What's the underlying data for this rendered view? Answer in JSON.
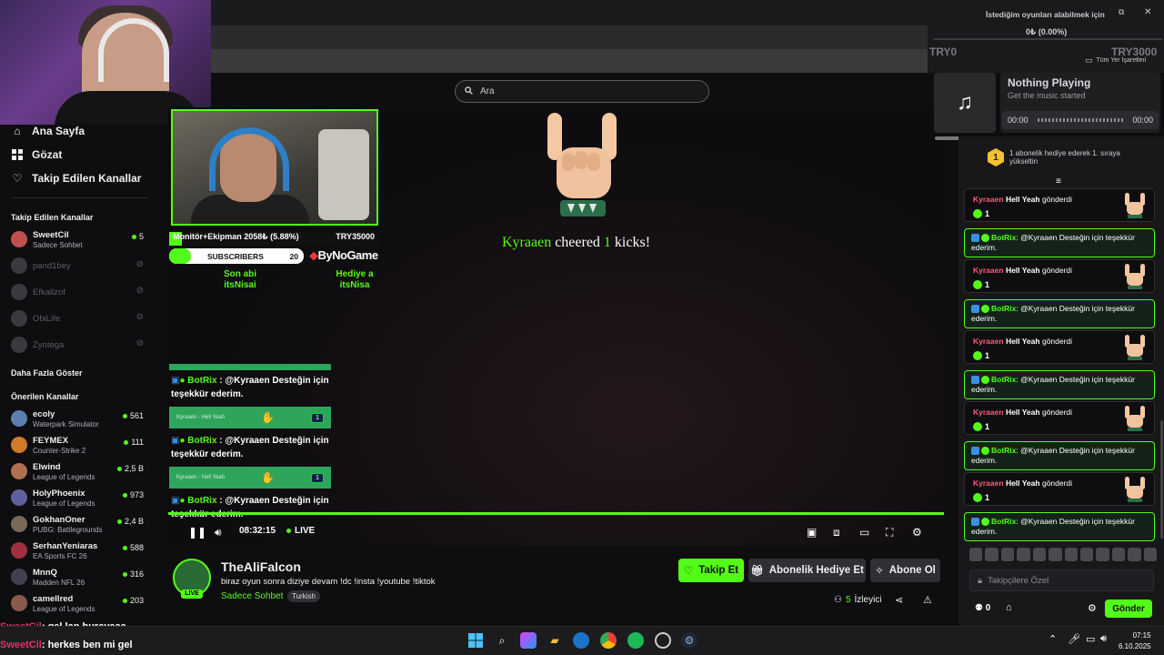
{
  "top": {
    "notice": "İstediğim oyunları alabilmek için",
    "progress": "0₺ (0.00%)",
    "goal_start": "TRY0",
    "goal_end": "TRY3000",
    "bookmarks": "Tüm Yer İşaretleri"
  },
  "search": {
    "placeholder": "Ara"
  },
  "sidebar": {
    "nav": [
      {
        "label": "Ana Sayfa",
        "icon": "home-icon"
      },
      {
        "label": "Gözat",
        "icon": "browse-icon"
      },
      {
        "label": "Takip Edilen Kanallar",
        "icon": "heart-icon"
      }
    ],
    "followed_title": "Takip Edilen Kanallar",
    "followed": [
      {
        "name": "SweetCil",
        "game": "Sadece Sohbet",
        "viewers": "5",
        "online": true,
        "color": "#c0504d"
      },
      {
        "name": "pand1bey",
        "online": false
      },
      {
        "name": "Efkalizof",
        "online": false
      },
      {
        "name": "ObiLife",
        "online": false
      },
      {
        "name": "Zyntega",
        "online": false
      }
    ],
    "show_more": "Daha Fazla Göster",
    "recommended_title": "Önerilen Kanallar",
    "recommended": [
      {
        "name": "ecoly",
        "game": "Waterpark Simulator",
        "viewers": "561",
        "color": "#5a7fb0"
      },
      {
        "name": "FEYMEX",
        "game": "Counter-Strike 2",
        "viewers": "111",
        "color": "#d07a2a"
      },
      {
        "name": "Elwind",
        "game": "League of Legends",
        "viewers": "2,5 B",
        "color": "#b07050"
      },
      {
        "name": "HolyPhoenix",
        "game": "League of Legends",
        "viewers": "973",
        "color": "#6060a0"
      },
      {
        "name": "GokhanOner",
        "game": "PUBG: Battlegrounds",
        "viewers": "2,4 B",
        "color": "#7a6a5a"
      },
      {
        "name": "SerhanYeniaras",
        "game": "EA Sports FC 26",
        "viewers": "588",
        "color": "#a03040"
      },
      {
        "name": "MnnQ",
        "game": "Madden NFL 26",
        "viewers": "316",
        "color": "#404050"
      },
      {
        "name": "camellred",
        "game": "League of Legends",
        "viewers": "203",
        "color": "#8a5a4a"
      }
    ]
  },
  "overlay": {
    "goal_label": "Monitör+Ekipman",
    "goal_value": "2058₺ (5.88%)",
    "goal_target": "TRY35000",
    "subs_label": "SUBSCRIBERS",
    "subs_count": "20",
    "sponsor": "ByNoGame",
    "left_line1": "Son abi",
    "left_line2": "itsNisai",
    "right_line1": "Hediye a",
    "right_line2": "itsNisa",
    "chat": [
      {
        "name": "BotRix",
        "text": ": @Kyraaen Desteğin için teşekkür ederim."
      },
      {
        "name": "BotRix",
        "text": ": @Kyraaen Desteğin için teşekkür ederim."
      },
      {
        "name": "BotRix",
        "text": ": @Kyraaen Desteğin için teşekkür ederim."
      }
    ],
    "alert_text": "Kyraaen - Hell Yeah",
    "alert_count": "1"
  },
  "cheer": {
    "user": "Kyraaen",
    "mid": "cheered",
    "amount": "1",
    "suffix": "kicks!"
  },
  "player": {
    "time": "08:32:15",
    "live": "LIVE",
    "progress_pct": 100
  },
  "stream": {
    "name": "TheAliFalcon",
    "title": "biraz oyun sonra diziye devam  !dc !insta !youtube !tiktok",
    "category": "Sadece Sohbet",
    "tag": "Turkish",
    "live": "LIVE",
    "viewers": "5",
    "viewers_label": "İzleyici",
    "follow": "Takip Et",
    "gift": "Abonelik Hediye Et",
    "subscribe": "Abone Ol"
  },
  "music": {
    "title": "Nothing Playing",
    "subtitle": "Get the music started",
    "start": "00:00",
    "end": "00:00"
  },
  "chat": {
    "hype": "1 abonelik hediye ederek 1. sıraya yükseltin",
    "gift_user": "Kyraaen",
    "gift_name": "Hell Yeah",
    "gift_sent": "gönderdi",
    "gift_count": "1",
    "bot_name": "BotRix",
    "bot_text": ": @Kyraaen Desteğin için teşekkür ederim.",
    "input_placeholder": "Takipçilere Özel",
    "send": "Gönder",
    "counter": "0"
  },
  "ticker": [
    {
      "user": "SweetCil",
      "text": ": gel lan burayaaa"
    },
    {
      "user": "SweetCil",
      "text": ": herkes ben mi gel"
    }
  ],
  "clock": {
    "time": "07:15",
    "date": "6.10.2025"
  },
  "colors": {
    "accent": "#53fc18",
    "bg": "#0e0e10",
    "panel": "#18181b"
  }
}
